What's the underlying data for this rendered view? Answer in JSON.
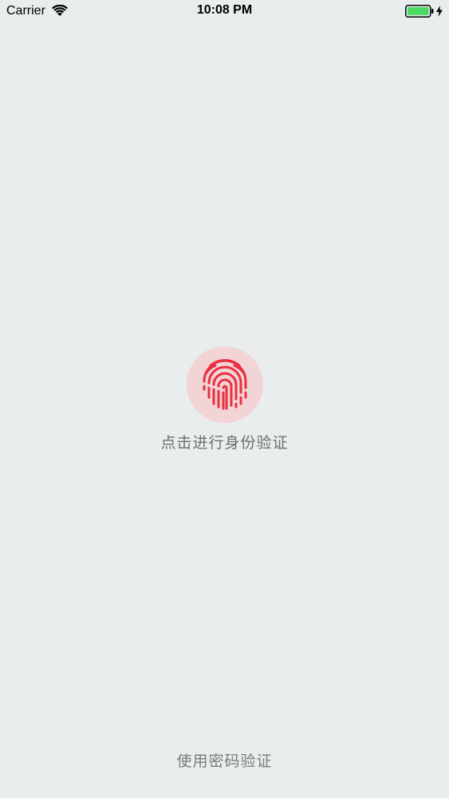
{
  "status_bar": {
    "carrier": "Carrier",
    "time": "10:08 PM",
    "battery_color": "#4cd964"
  },
  "main": {
    "fingerprint_color": "#e8313f",
    "fingerprint_bg": "#f2d3d6",
    "prompt": "点击进行身份验证",
    "password_link": "使用密码验证"
  }
}
